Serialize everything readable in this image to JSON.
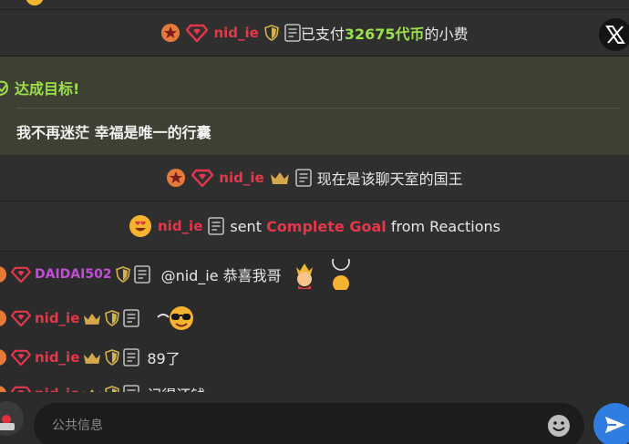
{
  "notices": {
    "tip": {
      "user": "nid_ie",
      "prefix": "已支付",
      "amount": "32675代币",
      "suffix": "的小费"
    },
    "goal": {
      "title": "达成目标!",
      "message": "我不再迷茫 幸福是唯一的行囊"
    },
    "king": {
      "user": "nid_ie",
      "text": "现在是该聊天室的国王"
    },
    "reaction": {
      "user": "nid_ie",
      "before": "sent",
      "highlight": "Complete Goal",
      "after": "from Reactions"
    }
  },
  "chat": [
    {
      "user": "DAIDAI502",
      "text": "@nid_ie  恭喜我哥"
    },
    {
      "user": "nid_ie",
      "text": ""
    },
    {
      "user": "nid_ie",
      "text": "89了"
    },
    {
      "user": "nid_ie",
      "text": "记得还钱"
    }
  ],
  "composer": {
    "placeholder": "公共信息"
  },
  "colors": {
    "accent": "#e5374a",
    "goal": "#9be14a",
    "send": "#2f7de1"
  }
}
